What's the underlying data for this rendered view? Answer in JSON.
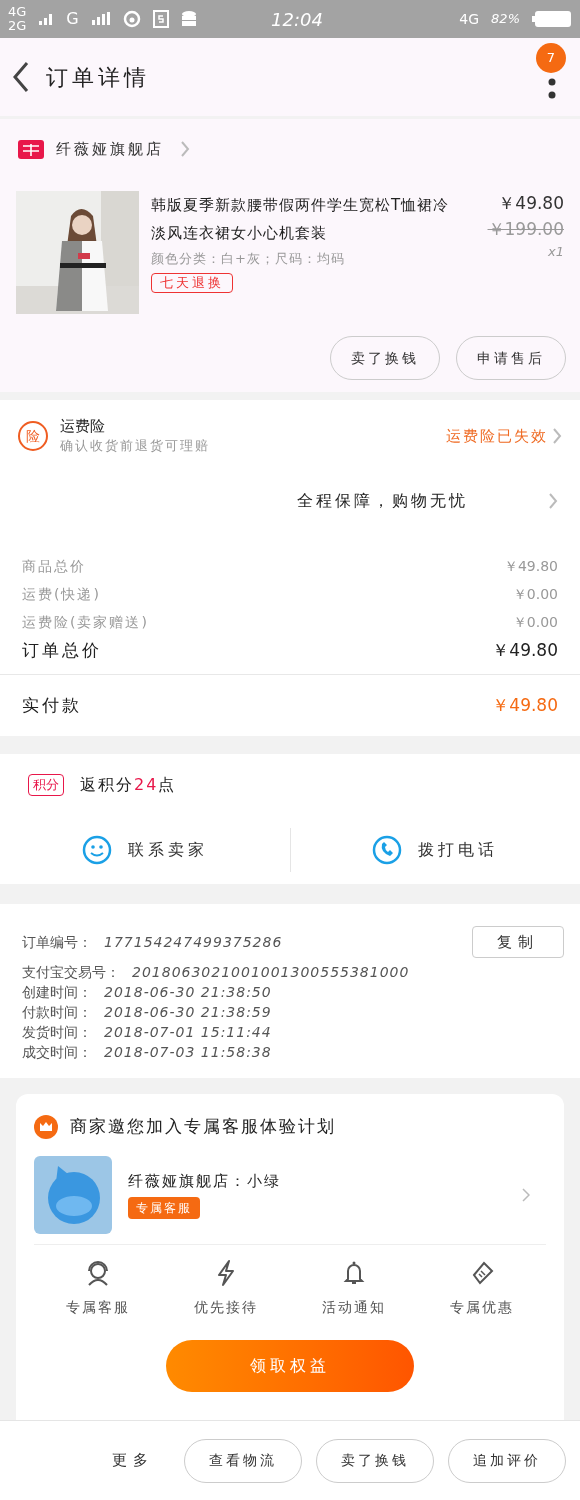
{
  "status_bar": {
    "left": [
      "4G",
      "2G",
      "G"
    ],
    "time": "12:04",
    "network": "4G",
    "battery": "82%"
  },
  "header": {
    "title": "订单详情",
    "badge": "7"
  },
  "store": {
    "name": "纤薇娅旗舰店"
  },
  "product": {
    "title": "韩版夏季新款腰带假两件学生宽松T恤裙冷淡风连衣裙女小心机套装",
    "sku": "颜色分类：白+灰；尺码：均码",
    "tag": "七天退换",
    "price": "￥49.80",
    "original_price": "￥199.00",
    "quantity": "x1",
    "buttons": [
      "卖了换钱",
      "申请售后"
    ]
  },
  "insurance": {
    "badge": "险",
    "title": "运费险",
    "subtitle": "确认收货前退货可理赔",
    "status": "运费险已失效"
  },
  "guarantee": "全程保障，购物无忧",
  "price_rows": [
    {
      "label": "商品总价",
      "value": "￥49.80"
    },
    {
      "label": "运费(快递)",
      "value": "￥0.00"
    },
    {
      "label": "运费险(卖家赠送)",
      "value": "￥0.00"
    }
  ],
  "order_total": {
    "label": "订单总价",
    "value": "￥49.80"
  },
  "paid": {
    "label": "实付款",
    "value": "￥49.80"
  },
  "points": {
    "badge": "积分",
    "prefix": "返积分",
    "amount": "24",
    "suffix": "点"
  },
  "contact": [
    "联系卖家",
    "拨打电话"
  ],
  "order_info": {
    "number_label": "订单编号：",
    "number": "177154247499375286",
    "copy": "复制",
    "rows": [
      {
        "label": "支付宝交易号：",
        "value": "2018063021001001300555381000"
      },
      {
        "label": "创建时间：",
        "value": "2018-06-30 21:38:50"
      },
      {
        "label": "付款时间：",
        "value": "2018-06-30 21:38:59"
      },
      {
        "label": "发货时间：",
        "value": "2018-07-01 15:11:44"
      },
      {
        "label": "成交时间：",
        "value": "2018-07-03 11:58:38"
      }
    ]
  },
  "service_card": {
    "title": "商家邀您加入专属客服体验计划",
    "agent": "纤薇娅旗舰店：小绿",
    "agent_tag": "专属客服",
    "perks": [
      {
        "kind": "agent",
        "label": "专属客服"
      },
      {
        "kind": "bolt",
        "label": "优先接待"
      },
      {
        "kind": "bell",
        "label": "活动通知"
      },
      {
        "kind": "ticket",
        "label": "专属优惠"
      }
    ],
    "cta": "领取权益"
  },
  "bottom_bar": {
    "more": "更多",
    "buttons": [
      "查看物流",
      "卖了换钱",
      "追加评价"
    ]
  }
}
